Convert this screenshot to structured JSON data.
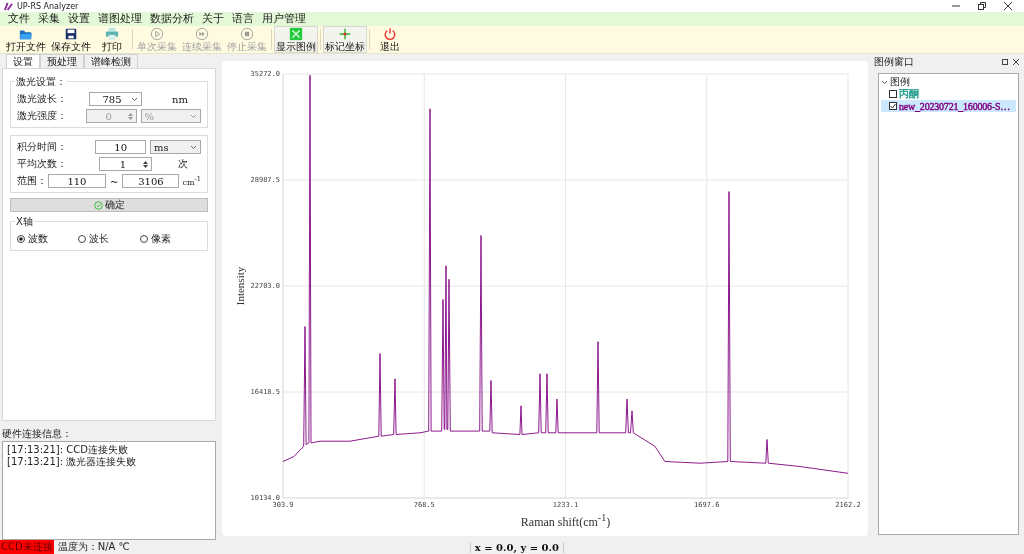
{
  "app": {
    "title": "UP-RS Analyzer"
  },
  "menu": [
    "文件",
    "采集",
    "设置",
    "谱图处理",
    "数据分析",
    "关于",
    "语言",
    "用户管理"
  ],
  "toolbar": [
    {
      "label": "打开文件",
      "disabled": false,
      "checked": false
    },
    {
      "label": "保存文件",
      "disabled": false,
      "checked": false
    },
    {
      "label": "打印",
      "disabled": false,
      "checked": false
    },
    {
      "label": "单次采集",
      "disabled": true,
      "checked": false
    },
    {
      "label": "连续采集",
      "disabled": true,
      "checked": false
    },
    {
      "label": "停止采集",
      "disabled": true,
      "checked": false
    },
    {
      "label": "显示图例",
      "disabled": false,
      "checked": true
    },
    {
      "label": "标记坐标",
      "disabled": false,
      "checked": true
    },
    {
      "label": "退出",
      "disabled": false,
      "checked": false
    }
  ],
  "left_tabs": [
    {
      "label": "设置",
      "selected": true
    },
    {
      "label": "预处理",
      "selected": false
    },
    {
      "label": "谱峰检测",
      "selected": false
    }
  ],
  "laser_group": {
    "title": "激光设置：",
    "wavelength": {
      "label": "激光波长：",
      "value": "785",
      "unit": "nm"
    },
    "power": {
      "label": "激光强度：",
      "value": "0",
      "unit": "%",
      "disabled": true
    }
  },
  "acquisition": {
    "integration": {
      "label": "积分时间：",
      "value": "10",
      "unit": "ms"
    },
    "average": {
      "label": "平均次数：",
      "value": "1",
      "unit": "次"
    },
    "range": {
      "label": "范围：",
      "from": "110",
      "separator": "~",
      "to": "3106",
      "unit": "cm$^{-1}$"
    }
  },
  "confirm_button": "确定",
  "x_axis": {
    "title": "X轴",
    "options": [
      {
        "label": "波数",
        "selected": true
      },
      {
        "label": "波长",
        "selected": false
      },
      {
        "label": "像素",
        "selected": false
      }
    ]
  },
  "hardware": {
    "title": "硬件连接信息：",
    "log": [
      "[17:13:21]: CCD连接失败",
      "[17:13:21]: 激光器连接失败"
    ]
  },
  "chart": {
    "chart_data": {
      "type": "line",
      "xlabel": "Raman shift(cm$^{-1}$)",
      "ylabel": "Intensity",
      "xlim": [
        303.9,
        2162.2
      ],
      "ylim": [
        10134.0,
        35272.0
      ],
      "xticks": [
        {
          "value": 303.9,
          "label": "303.9"
        },
        {
          "value": 768.5,
          "label": "768.5"
        },
        {
          "value": 1233.1,
          "label": "1233.1"
        },
        {
          "value": 1697.6,
          "label": "1697.6"
        },
        {
          "value": 2162.2,
          "label": "2162.2"
        }
      ],
      "yticks": [
        {
          "value": 10134.0,
          "label": "10134.0"
        },
        {
          "value": 16418.5,
          "label": "16418.5"
        },
        {
          "value": 22703.0,
          "label": "22703.0"
        },
        {
          "value": 28987.5,
          "label": "28987.5"
        },
        {
          "value": 35272.0,
          "label": "35272.0"
        }
      ],
      "grid": true,
      "x": [
        303.9,
        340,
        372,
        376.3,
        380,
        389,
        392.8,
        396,
        425.6,
        524.3,
        619,
        623.0,
        627,
        668,
        672.3,
        676,
        754.5,
        783,
        787.4,
        791,
        826,
        830.1,
        834,
        836,
        840.0,
        843,
        846,
        850.0,
        854,
        951,
        955.1,
        959,
        984,
        988.0,
        992,
        1083,
        1086.7,
        1090,
        1145,
        1149.2,
        1153,
        1168,
        1172.2,
        1176,
        1201,
        1205.1,
        1209,
        1336,
        1339.9,
        1344,
        1431,
        1435.3,
        1440,
        1447,
        1451.7,
        1456,
        1527,
        1560,
        1675,
        1767,
        1770.8,
        1775,
        1892,
        1895.8,
        1900,
        2004,
        2162.2
      ],
      "series": [
        {
          "color": "#800080",
          "values": [
            12300,
            12600,
            13200,
            20300,
            13300,
            13400,
            35200,
            13400,
            13500,
            13500,
            13800,
            18700,
            13800,
            13900,
            17200,
            13900,
            14000,
            14100,
            33200,
            14100,
            14100,
            21900,
            14200,
            14200,
            23900,
            14200,
            14200,
            23100,
            14100,
            14100,
            25700,
            14100,
            14100,
            17100,
            14000,
            13900,
            15600,
            13900,
            14000,
            17500,
            14000,
            14000,
            17500,
            14000,
            14000,
            16000,
            14000,
            14000,
            19400,
            14000,
            14000,
            16000,
            14000,
            14000,
            15300,
            14000,
            13200,
            12300,
            12200,
            12300,
            28300,
            12300,
            12200,
            13600,
            12200,
            12000,
            11600
          ]
        }
      ]
    }
  },
  "legend_panel": {
    "title": "图例窗口",
    "tree": [
      {
        "label": "图例",
        "expanded": true,
        "children": [
          {
            "label": "丙酮",
            "checked": false,
            "selected": false,
            "color": "#1a9a8a"
          },
          {
            "label": "new_20230721_160006-S…",
            "checked": true,
            "selected": true,
            "color": "#800080"
          }
        ]
      }
    ]
  },
  "status": {
    "ccd": "CCD未连接",
    "ccd_connected": false,
    "temperature": "温度为：N/A ℃",
    "coords": "x = 0.0,  y = 0.0"
  }
}
